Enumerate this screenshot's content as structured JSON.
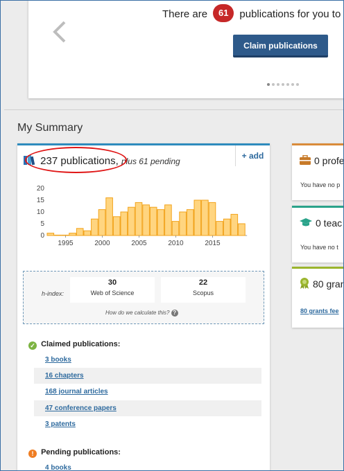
{
  "banner": {
    "text_before": "There are",
    "count": "61",
    "text_after": "publications for you to cl",
    "claim_button": "Claim publications"
  },
  "summary": {
    "title": "My Summary"
  },
  "publications_card": {
    "count_text": "237 publications,",
    "pending_text": "plus 61 pending",
    "add_label": "+ add",
    "chart_data": {
      "type": "bar",
      "title": "",
      "xlabel": "",
      "ylabel": "",
      "x": [
        1993,
        1994,
        1995,
        1996,
        1997,
        1998,
        1999,
        2000,
        2001,
        2002,
        2003,
        2004,
        2005,
        2006,
        2007,
        2008,
        2009,
        2010,
        2011,
        2012,
        2013,
        2014,
        2015,
        2016,
        2017,
        2018,
        2019
      ],
      "values": [
        1,
        0,
        0,
        1,
        3,
        2,
        7,
        11,
        16,
        8,
        10,
        12,
        14,
        13,
        12,
        11,
        13,
        6,
        10,
        11,
        15,
        15,
        14,
        6,
        7,
        9,
        5
      ],
      "x_ticks": [
        "1995",
        "2000",
        "2005",
        "2010",
        "2015"
      ],
      "y_ticks": [
        "0",
        "5",
        "10",
        "15",
        "20"
      ],
      "ylim": [
        0,
        20
      ],
      "colors": {
        "fill": "#ffd580",
        "stroke": "#f2a31b"
      }
    },
    "hindex": {
      "label": "h-index:",
      "wos_value": "30",
      "wos_label": "Web of Science",
      "scopus_value": "22",
      "scopus_label": "Scopus",
      "calc_link": "How do we calculate this?"
    },
    "claimed": {
      "heading": "Claimed publications:",
      "items": [
        "3 books",
        "16 chapters",
        "168 journal articles",
        "47 conference papers",
        "3 patents"
      ]
    },
    "pending": {
      "heading": "Pending publications:",
      "items": [
        "4 books"
      ]
    }
  },
  "side": {
    "prof_title": "0 profe",
    "prof_text": "You have no p",
    "teach_title": "0 teac",
    "teach_text": "You have no t",
    "grants_title": "80 gran",
    "grants_link": "80 grants fee"
  },
  "colors": {
    "accent_blue": "#2e8bbd",
    "link": "#2e6a9e",
    "badge_red": "#c62828",
    "claim_button": "#2e5a8a",
    "prof_border": "#d98b3a",
    "teach_border": "#2aa38a",
    "grants_border": "#9bb52e"
  }
}
